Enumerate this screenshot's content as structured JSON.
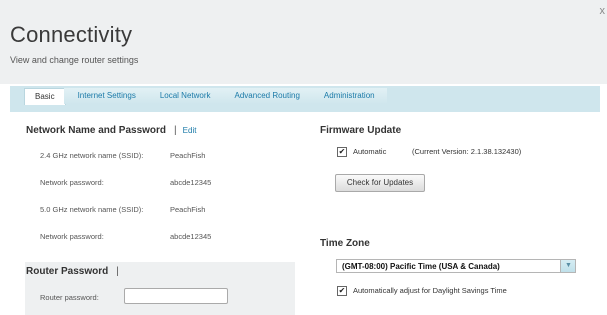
{
  "header": {
    "title": "Connectivity",
    "subtitle": "View and change router settings",
    "close_label": "x"
  },
  "tabs": [
    {
      "label": "Basic",
      "active": true
    },
    {
      "label": "Internet Settings",
      "active": false
    },
    {
      "label": "Local Network",
      "active": false
    },
    {
      "label": "Advanced Routing",
      "active": false
    },
    {
      "label": "Administration",
      "active": false
    }
  ],
  "network": {
    "title": "Network Name and Password",
    "separator": "|",
    "edit_label": "Edit",
    "rows": [
      {
        "label": "2.4 GHz network name (SSID):",
        "value": "PeachFish"
      },
      {
        "label": "Network password:",
        "value": "abcde12345"
      },
      {
        "label": "5.0 GHz network name (SSID):",
        "value": "PeachFish"
      },
      {
        "label": "Network password:",
        "value": "abcde12345"
      }
    ]
  },
  "router_password": {
    "title": "Router Password",
    "separator": "|",
    "field_label": "Router password:",
    "field_value": ""
  },
  "firmware": {
    "title": "Firmware Update",
    "automatic_label": "Automatic",
    "automatic_checked": true,
    "current_version": "(Current Version: 2.1.38.132430)",
    "check_button": "Check for Updates"
  },
  "timezone": {
    "title": "Time Zone",
    "selected": "(GMT-08:00) Pacific Time (USA & Canada)",
    "dst_label": "Automatically adjust for Daylight Savings Time",
    "dst_checked": true
  },
  "colors": {
    "link": "#1b7aa8",
    "tab_bg": "#cfe6ed",
    "header_bg": "#eef0f1"
  },
  "icons": {
    "checkmark": "✔",
    "dropdown": "▼"
  }
}
